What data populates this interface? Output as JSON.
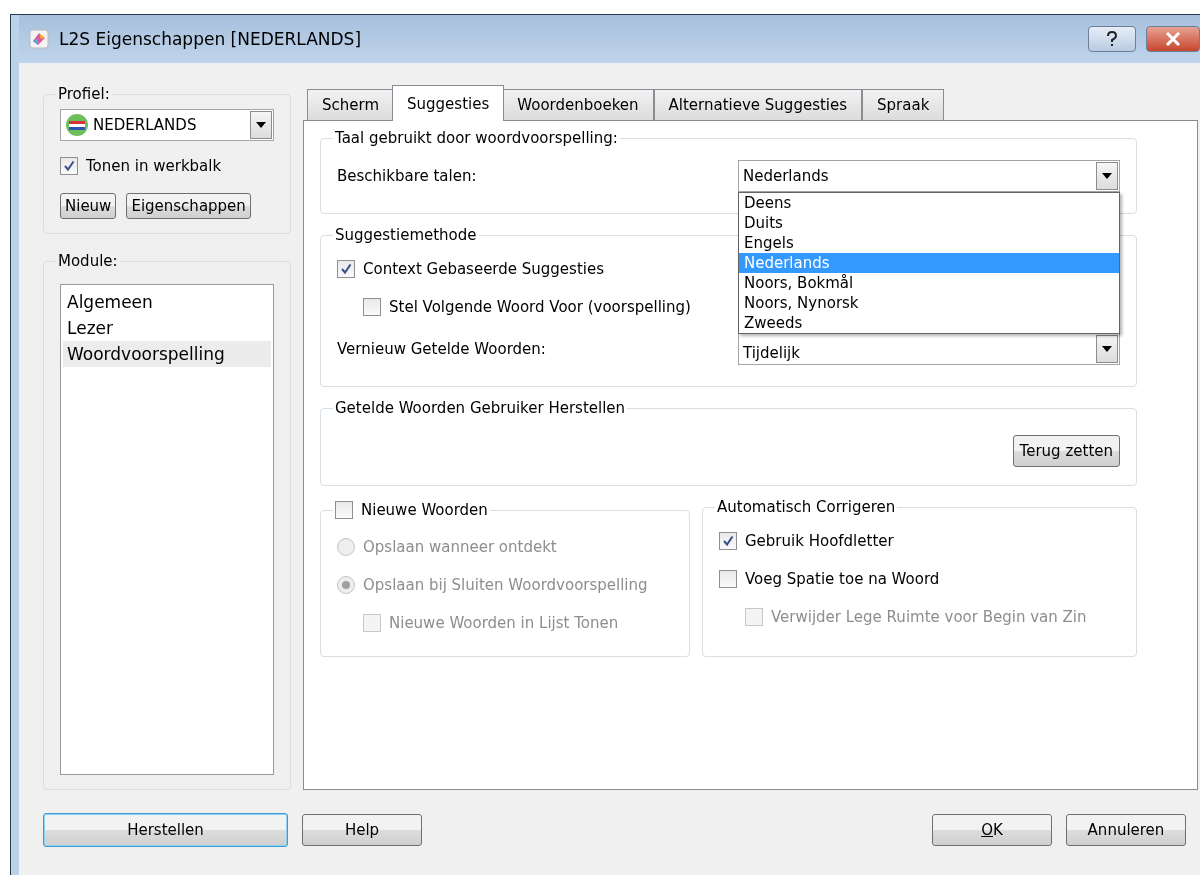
{
  "window": {
    "title": "L2S Eigenschappen [NEDERLANDS]"
  },
  "profile": {
    "label": "Profiel:",
    "value": "NEDERLANDS",
    "show_in_toolbar": {
      "label": "Tonen in werkbalk",
      "checked": true
    },
    "buttons": [
      "Nieuw",
      "Eigenschappen"
    ]
  },
  "module": {
    "label": "Module:",
    "items": [
      {
        "label": "Algemeen",
        "selected": false
      },
      {
        "label": "Lezer",
        "selected": false
      },
      {
        "label": "Woordvoorspelling",
        "selected": true
      }
    ]
  },
  "tabs": [
    {
      "label": "Scherm",
      "selected": false
    },
    {
      "label": "Suggesties",
      "selected": true
    },
    {
      "label": "Woordenboeken",
      "selected": false
    },
    {
      "label": "Alternatieve Suggesties",
      "selected": false
    },
    {
      "label": "Spraak",
      "selected": false
    }
  ],
  "language_group": {
    "title": "Taal gebruikt door woordvoorspelling:",
    "label": "Beschikbare talen:",
    "value": "Nederlands",
    "expanded": true,
    "options": [
      {
        "label": "Deens",
        "selected": false
      },
      {
        "label": "Duits",
        "selected": false
      },
      {
        "label": "Engels",
        "selected": false
      },
      {
        "label": "Nederlands",
        "selected": true
      },
      {
        "label": "Noors, Bokmål",
        "selected": false
      },
      {
        "label": "Noors, Nynorsk",
        "selected": false
      },
      {
        "label": "Zweeds",
        "selected": false
      }
    ]
  },
  "method_group": {
    "title": "Suggestiemethode",
    "options": [
      {
        "kind": "checkbox",
        "label": "Context Gebaseerde Suggesties",
        "checked": true,
        "disabled": false,
        "children": [
          {
            "kind": "checkbox",
            "label": "Stel Volgende Woord Voor (voorspelling)",
            "checked": false,
            "disabled": false
          }
        ]
      }
    ],
    "renew_label": "Vernieuw Getelde Woorden:",
    "renew_value": "Tijdelijk"
  },
  "reset_group": {
    "title": "Getelde Woorden Gebruiker Herstellen",
    "button": "Terug zetten"
  },
  "new_words": {
    "title": "Nieuwe Woorden",
    "checked": false,
    "options": [
      {
        "kind": "radio",
        "label": "Opslaan wanneer ontdekt",
        "selected": false,
        "disabled": true
      },
      {
        "kind": "radio",
        "label": "Opslaan bij Sluiten Woordvoorspelling",
        "selected": true,
        "disabled": true,
        "children": [
          {
            "kind": "checkbox",
            "label": "Nieuwe Woorden in Lijst Tonen",
            "checked": false,
            "disabled": true
          }
        ]
      }
    ]
  },
  "autocorrect": {
    "title": "Automatisch Corrigeren",
    "options": [
      {
        "kind": "checkbox",
        "label": "Gebruik Hoofdletter",
        "checked": true,
        "disabled": false
      },
      {
        "kind": "checkbox",
        "label": "Voeg Spatie toe na Woord",
        "checked": false,
        "disabled": false,
        "children": [
          {
            "kind": "checkbox",
            "label": "Verwijder Lege Ruimte voor Begin van Zin",
            "checked": false,
            "disabled": true
          }
        ]
      }
    ]
  },
  "footer": {
    "left_buttons": [
      {
        "label": "Herstellen",
        "focused": true,
        "mnemonic": false
      },
      {
        "label": "Help",
        "focused": false,
        "mnemonic": false
      }
    ],
    "right_buttons": [
      {
        "label": "OK",
        "focused": false,
        "mnemonic": true
      },
      {
        "label": "Annuleren",
        "focused": false,
        "mnemonic": false
      }
    ]
  }
}
